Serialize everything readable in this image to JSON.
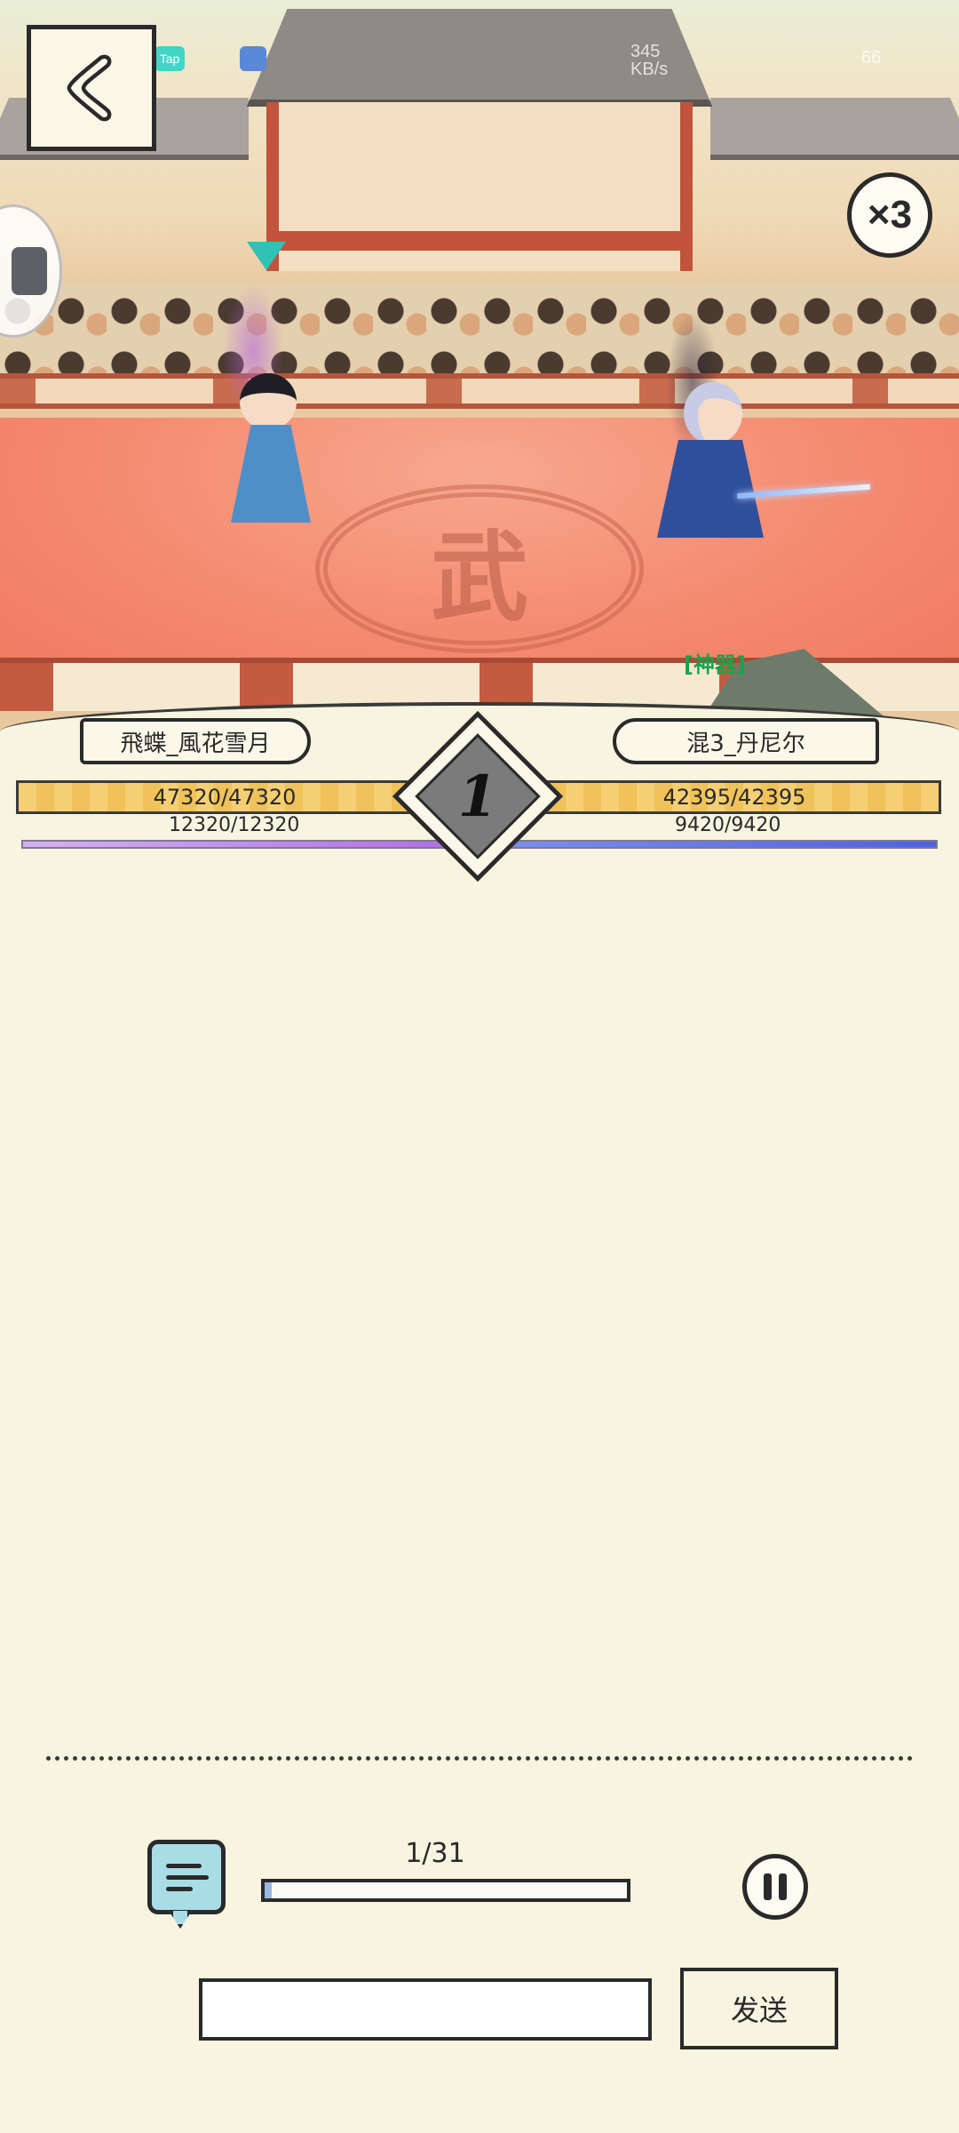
{
  "arena": {
    "floor_emblem": "武",
    "opponent_tag": "[神器]",
    "speed": "×3"
  },
  "statusbar": {
    "app_badge": "Tap",
    "network_speed": "345\nKB/s",
    "battery": "66"
  },
  "player_left": {
    "name": "飛蝶_風花雪月",
    "hp_text": "47320/47320",
    "hp_fraction": 1.0,
    "mp_text": "12320/12320",
    "mp_fraction": 1.0
  },
  "player_right": {
    "name": "混3_丹尼尔",
    "hp_text": "42395/42395",
    "hp_fraction": 1.0,
    "mp_text": "9420/9420",
    "mp_fraction": 1.0
  },
  "round": {
    "number": "1"
  },
  "controls": {
    "progress_label": "1/31",
    "progress_fraction": 0.02,
    "chat_placeholder": "",
    "send_label": "发送"
  },
  "colors": {
    "background": "#f7f4df",
    "hp": "#f3c869",
    "mp_left": "#b26ae6",
    "mp_right": "#4b63e2",
    "turn_marker": "#2fc2b6"
  }
}
